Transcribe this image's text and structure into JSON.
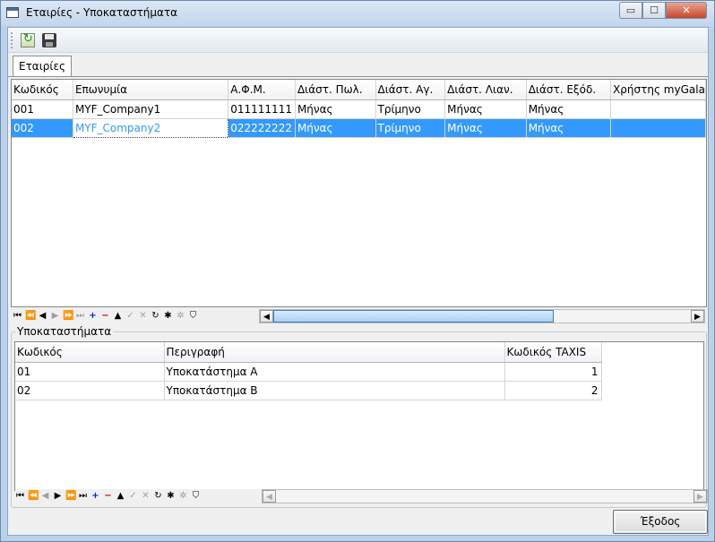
{
  "window": {
    "title": "Εταιρίες - Υποκαταστήματα"
  },
  "titlebar_buttons": {
    "minimize": "▭",
    "maximize": "☐",
    "close": "✕"
  },
  "toolbar": {
    "icons": [
      "refresh-icon",
      "save-icon"
    ]
  },
  "tabs": [
    {
      "label": "Εταιρίες"
    }
  ],
  "companies": {
    "columns": [
      "Κωδικός",
      "Επωνυμία",
      "Α.Φ.Μ.",
      "Διάστ. Πωλ.",
      "Διάστ. Αγ.",
      "Διάστ. Λιαν.",
      "Διάστ. Εξόδ.",
      "Χρήστης myGala"
    ],
    "rows": [
      [
        "001",
        "MYF_Company1",
        "011111111",
        "Μήνας",
        "Τρίμηνο",
        "Μήνας",
        "Μήνας",
        ""
      ],
      [
        "002",
        "MYF_Company2",
        "022222222",
        "Μήνας",
        "Τρίμηνο",
        "Μήνας",
        "Μήνας",
        ""
      ]
    ],
    "selected_row": 1
  },
  "navigator": {
    "buttons": [
      "⏮",
      "⏪",
      "◀",
      "▶",
      "⏩",
      "⏭",
      "+",
      "−",
      "▲",
      "✓",
      "✕",
      "↻",
      "✱",
      "✲",
      "⛉"
    ]
  },
  "branches": {
    "group_title": "Υποκαταστήματα",
    "columns": [
      "Κωδικός",
      "Περιγραφή",
      "Κωδικός TAXIS"
    ],
    "rows": [
      [
        "01",
        "Υποκατάστημα A",
        "1"
      ],
      [
        "02",
        "Υποκατάστημα B",
        "2"
      ]
    ]
  },
  "exit_button": {
    "label": "Έξοδος"
  },
  "colors": {
    "selection": "#3399ff",
    "window_frame": "#b9d1ea"
  }
}
